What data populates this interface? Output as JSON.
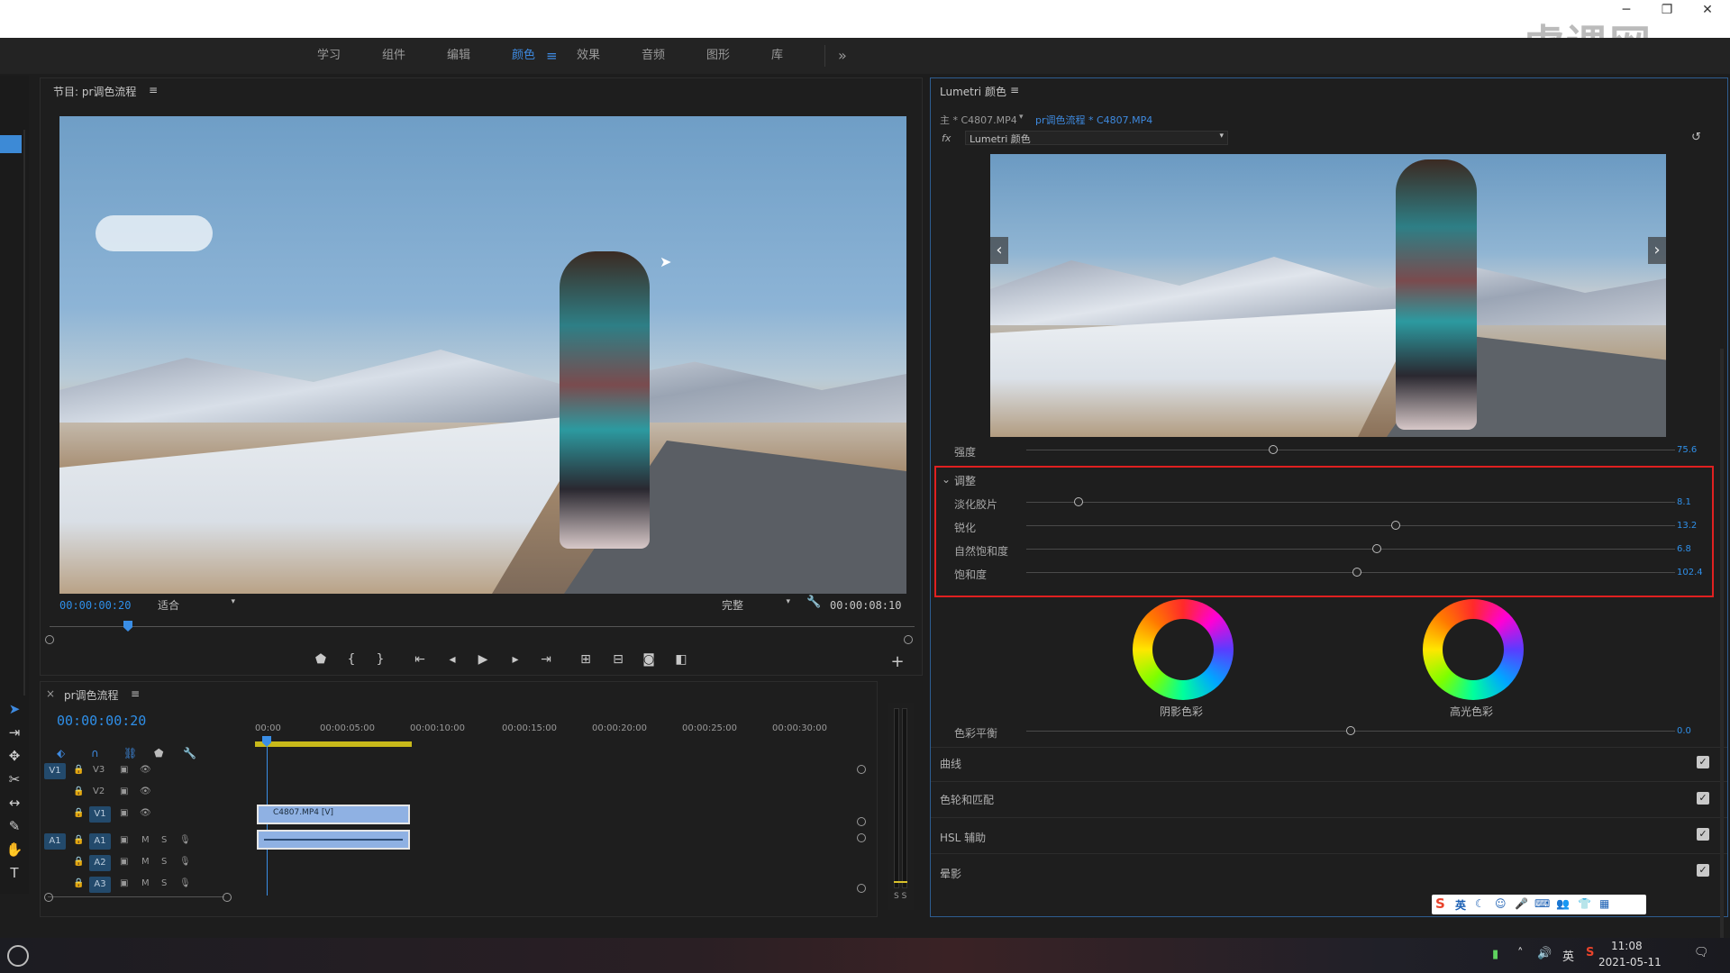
{
  "window": {
    "minimize": "─",
    "restore": "❐",
    "close": "✕"
  },
  "watermark": "虎课网",
  "workspaces": {
    "items": [
      "学习",
      "组件",
      "编辑",
      "颜色",
      "效果",
      "音频",
      "图形",
      "库"
    ],
    "active": "颜色",
    "menu_icon": "≡",
    "more": "»"
  },
  "program_monitor": {
    "title": "节目: pr调色流程",
    "menu_icon": "≡",
    "timecode": "00:00:00:20",
    "fit": "适合",
    "quality": "完整",
    "duration": "00:00:08:10",
    "controls": [
      "marker-icon",
      "mark-in-icon",
      "mark-out-icon",
      "go-to-in-icon",
      "step-back-icon",
      "play-icon",
      "step-forward-icon",
      "go-to-out-icon",
      "insert-icon",
      "overwrite-icon",
      "camera-icon",
      "compare-icon"
    ],
    "add": "+"
  },
  "timeline": {
    "title": "pr调色流程",
    "close": "×",
    "menu_icon": "≡",
    "timecode": "00:00:00:20",
    "ruler": [
      "00:00",
      "00:00:05:00",
      "00:00:10:00",
      "00:00:15:00",
      "00:00:20:00",
      "00:00:25:00",
      "00:00:30:00"
    ],
    "video_tracks": [
      {
        "source": "V1",
        "name": "V3"
      },
      {
        "source": "",
        "name": "V2"
      },
      {
        "source": "",
        "name": "V1"
      }
    ],
    "audio_tracks": [
      {
        "source": "A1",
        "name": "A1"
      },
      {
        "source": "",
        "name": "A2"
      },
      {
        "source": "",
        "name": "A3"
      }
    ],
    "mute": "M",
    "solo": "S",
    "clip_video": "C4807.MP4 [V]",
    "meter_labels": "S S"
  },
  "lumetri": {
    "title": "Lumetri 颜色",
    "menu_icon": "≡",
    "master": "主 * C4807.MP4",
    "sequence": "pr调色流程 * C4807.MP4",
    "fx": "fx",
    "effect": "Lumetri 颜色",
    "intensity": {
      "label": "强度",
      "value": "75.6",
      "position": 0.38
    },
    "adjust": {
      "header": "调整",
      "sliders": [
        {
          "label": "淡化胶片",
          "value": "8.1",
          "position": 0.08
        },
        {
          "label": "锐化",
          "value": "13.2",
          "position": 0.57
        },
        {
          "label": "自然饱和度",
          "value": "6.8",
          "position": 0.54
        },
        {
          "label": "饱和度",
          "value": "102.4",
          "position": 0.51
        }
      ]
    },
    "wheels": {
      "shadow": "阴影色彩",
      "highlight": "高光色彩"
    },
    "balance": {
      "label": "色彩平衡",
      "value": "0.0",
      "position": 0.5
    },
    "sections": [
      "曲线",
      "色轮和匹配",
      "HSL 辅助",
      "晕影"
    ]
  },
  "ime": {
    "lang": "英",
    "items": [
      "moon-icon",
      "emoji-icon",
      "mic-icon",
      "keyboard-icon",
      "people-icon",
      "shirt-icon",
      "grid-icon"
    ]
  },
  "taskbar": {
    "lang": "英",
    "time": "11:08",
    "date": "2021-05-11"
  },
  "colors": {
    "accent": "#2f8fe8",
    "highlight_box": "#e02020",
    "panel": "#1e1e1e"
  }
}
